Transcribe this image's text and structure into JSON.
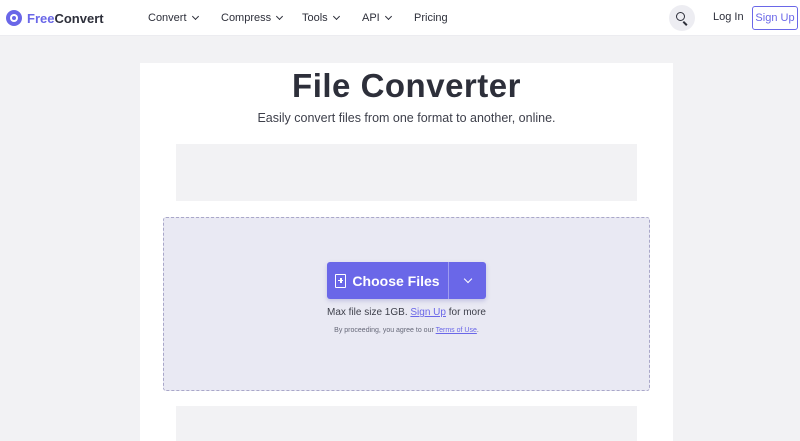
{
  "header": {
    "logo": {
      "part1": "Free",
      "part2": "Convert"
    },
    "nav": [
      {
        "label": "Convert",
        "has_dropdown": true
      },
      {
        "label": "Compress",
        "has_dropdown": true
      },
      {
        "label": "Tools",
        "has_dropdown": true
      },
      {
        "label": "API",
        "has_dropdown": true
      },
      {
        "label": "Pricing",
        "has_dropdown": false
      }
    ],
    "search_icon": "search-icon",
    "login_label": "Log In",
    "signup_label": "Sign Up"
  },
  "main": {
    "title": "File Converter",
    "subtitle": "Easily convert files from one format to another, online.",
    "choose_button": {
      "label": "Choose Files",
      "icon": "file-plus-icon",
      "dropdown_icon": "chevron-down-icon"
    },
    "max_size": {
      "prefix": "Max file size 1GB.",
      "link": "Sign Up",
      "suffix": "for more"
    },
    "terms": {
      "prefix": "By proceeding, you agree to our",
      "link": "Terms of Use",
      "suffix": "."
    }
  },
  "colors": {
    "accent": "#6a67e8",
    "dropzone_bg": "#e9e9f3",
    "page_bg": "#f2f2f4"
  }
}
